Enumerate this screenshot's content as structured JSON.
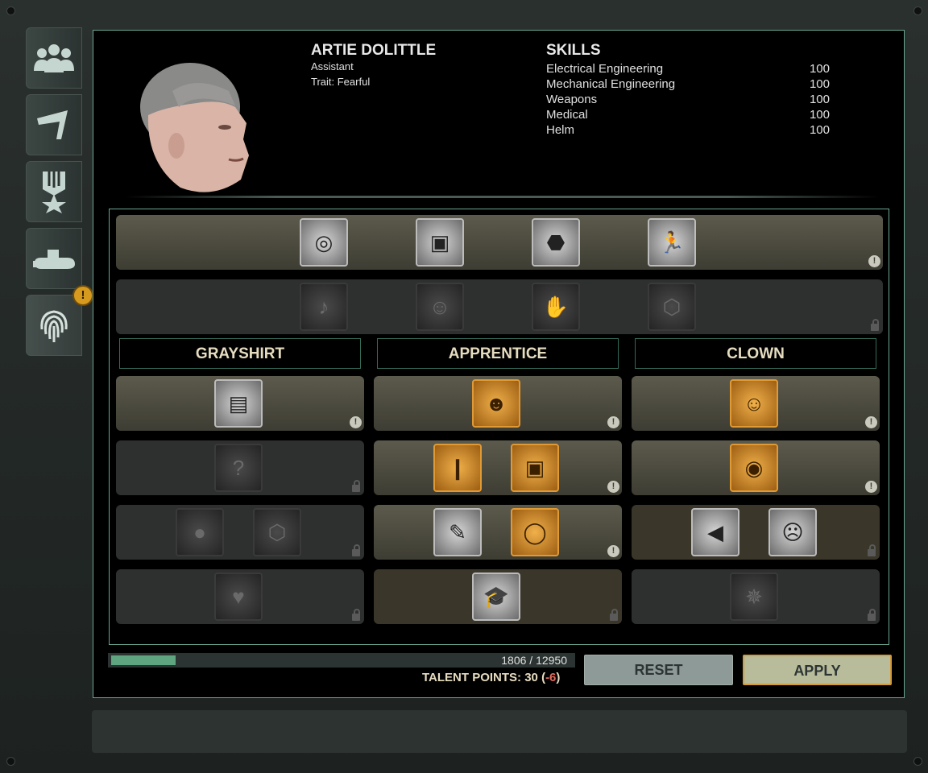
{
  "sidebar": {
    "tabs": [
      {
        "icon": "crew-icon"
      },
      {
        "icon": "flag-icon"
      },
      {
        "icon": "medal-icon"
      },
      {
        "icon": "submarine-icon"
      },
      {
        "icon": "fingerprint-icon",
        "alert": "!"
      }
    ]
  },
  "character": {
    "name": "ARTIE DOLITTLE",
    "role": "Assistant",
    "trait": "Trait: Fearful"
  },
  "skills": {
    "title": "SKILLS",
    "items": [
      {
        "name": "Electrical Engineering",
        "value": "100"
      },
      {
        "name": "Mechanical Engineering",
        "value": "100"
      },
      {
        "name": "Weapons",
        "value": "100"
      },
      {
        "name": "Medical",
        "value": "100"
      },
      {
        "name": "Helm",
        "value": "100"
      }
    ]
  },
  "tree": {
    "general_rows": [
      {
        "state": "lit",
        "marker": "!",
        "talents": [
          {
            "icon": "swirl-icon"
          },
          {
            "icon": "crate-icon"
          },
          {
            "icon": "turtle-icon"
          },
          {
            "icon": "running-man-icon"
          }
        ]
      },
      {
        "state": "locked",
        "talents": [
          {
            "icon": "music-note-icon"
          },
          {
            "icon": "jack-in-box-icon"
          },
          {
            "icon": "handshake-icon"
          },
          {
            "icon": "coffin-icon"
          }
        ]
      }
    ],
    "columns": [
      {
        "title": "GRAYSHIRT"
      },
      {
        "title": "APPRENTICE"
      },
      {
        "title": "CLOWN"
      }
    ],
    "markers": {
      "available": "!"
    }
  },
  "progress": {
    "text": "1806 / 12950",
    "fraction": 0.1395
  },
  "talent_points": {
    "label": "TALENT POINTS: 30 (",
    "delta": "-6",
    "close": ")"
  },
  "buttons": {
    "reset": "RESET",
    "apply": "APPLY"
  }
}
